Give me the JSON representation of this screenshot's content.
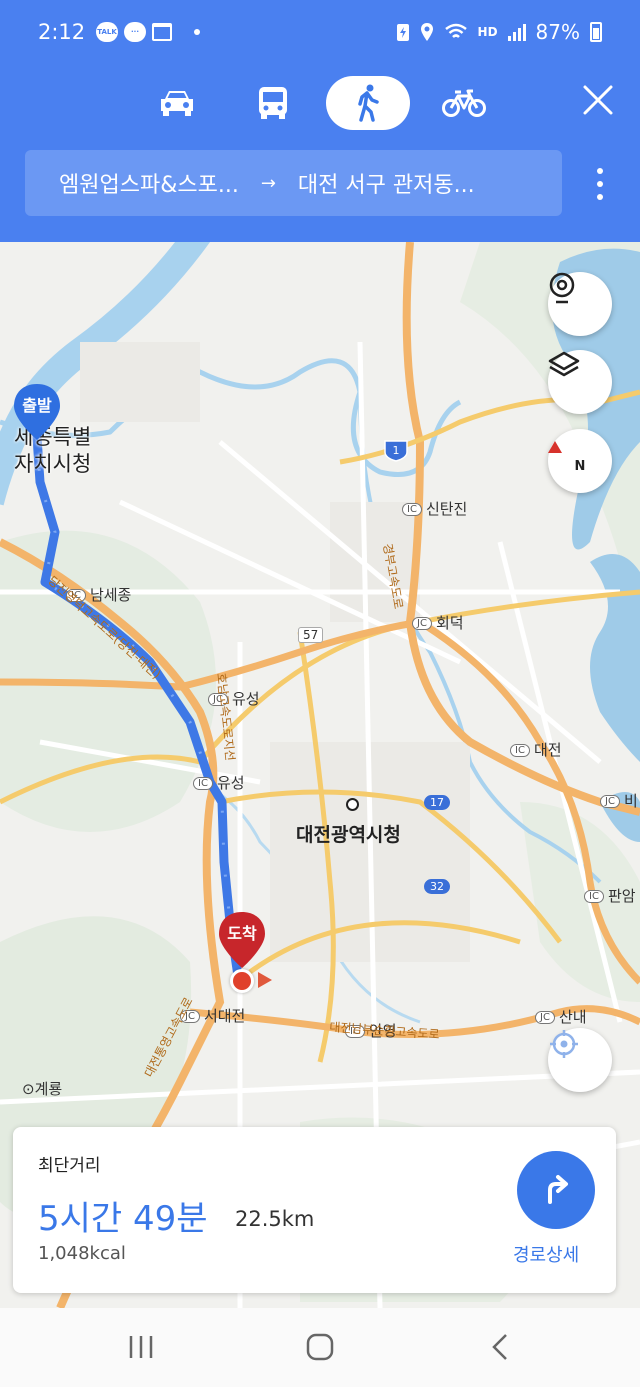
{
  "status_bar": {
    "time": "2:12",
    "talk_badge": "TALK",
    "hd_label": "HD",
    "battery": "87%"
  },
  "transport_modes": [
    {
      "name": "car",
      "icon": "car-icon",
      "active": false
    },
    {
      "name": "bus",
      "icon": "bus-icon",
      "active": false
    },
    {
      "name": "walk",
      "icon": "walk-icon",
      "active": true
    },
    {
      "name": "bike",
      "icon": "bike-icon",
      "active": false
    }
  ],
  "route": {
    "origin": "엠원업스파&스포...",
    "arrow": "→",
    "destination": "대전 서구 관저동..."
  },
  "map": {
    "labels": {
      "sejong_city": "세종특별\n자치시청",
      "daejeon_city_hall": "대전광역시청",
      "gyeryong": "계룡",
      "sintanjin": "신탄진",
      "hoedeok": "회덕",
      "namsejong": "남세종",
      "yuseong_jc": "유성",
      "yuseong_ic": "유성",
      "daejeon_ic": "대전",
      "biryong": "비",
      "panam": "판암",
      "seodaejeon": "서대전",
      "anyeong": "안영",
      "sannae": "산내",
      "daejeon_tong": "대전통",
      "highway_daejeon_tongyeong": "대전통영고속도로",
      "highway_gyeongbu": "경부고속도로",
      "highway_dangjin_daejeon": "당진영덕고속도로(당진-대전)",
      "highway_honam": "호남고속도로지선",
      "highway_daejeon_ring": "대전남부순환고속도로"
    },
    "badges": {
      "ic": "IC",
      "jc": "JC",
      "route_1": "1",
      "route_57": "57",
      "route_17": "17",
      "route_32": "32"
    },
    "start_pin": "출발",
    "end_pin": "도착"
  },
  "card": {
    "title": "최단거리",
    "duration": "5시간 49분",
    "distance": "22.5km",
    "calories": "1,048kcal",
    "detail_label": "경로상세"
  },
  "colors": {
    "header": "#4a80f0",
    "accent": "#3a78e8",
    "route_line": "#3e78e6",
    "start_pin": "#2f6fe0",
    "end_pin": "#c7262b",
    "highway": "#f5c07a"
  }
}
